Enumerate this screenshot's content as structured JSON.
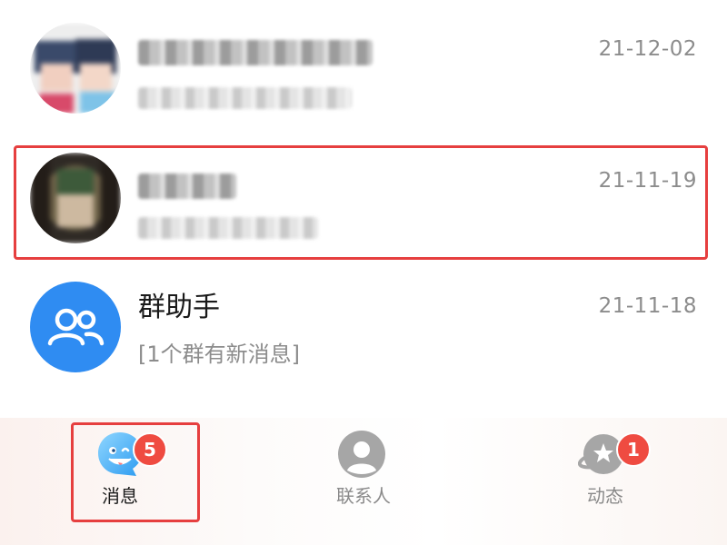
{
  "conversations": [
    {
      "title": "",
      "preview": "",
      "time": "21-12-02",
      "avatar_icon": "blurred-avatar-icon",
      "blurred": true
    },
    {
      "title": "",
      "preview": "",
      "time": "21-11-19",
      "avatar_icon": "blurred-avatar-icon",
      "blurred": true,
      "highlighted": true
    },
    {
      "title": "群助手",
      "preview": "[1个群有新消息]",
      "time": "21-11-18",
      "avatar_icon": "group-assistant-icon",
      "blurred": false
    }
  ],
  "tabbar": {
    "tabs": [
      {
        "label": "消息",
        "icon": "messages-icon",
        "badge": "5",
        "active": true
      },
      {
        "label": "联系人",
        "icon": "contacts-icon",
        "badge": "",
        "active": false
      },
      {
        "label": "动态",
        "icon": "moments-icon",
        "badge": "1",
        "active": false
      }
    ]
  },
  "colors": {
    "highlight_border": "#e63f3f",
    "badge": "#ef4b41",
    "group_assistant_bg": "#2f8cf2",
    "primary_text": "#1a1a1a",
    "secondary_text": "#8c8c8c"
  }
}
